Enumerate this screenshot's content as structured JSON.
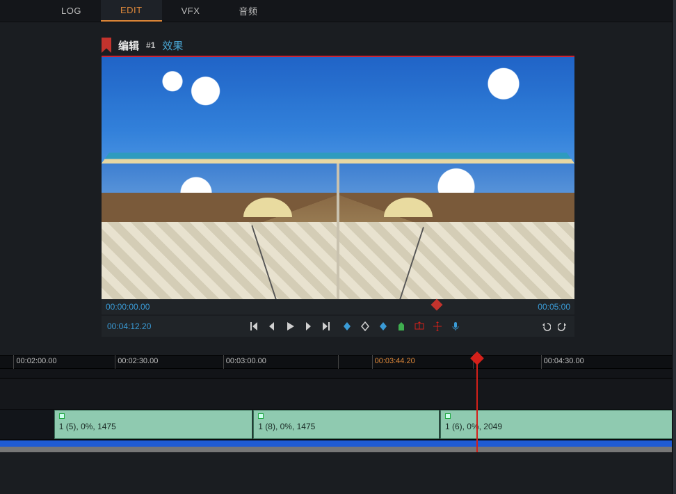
{
  "tabs": {
    "log": "LOG",
    "edit": "EDIT",
    "vfx": "VFX",
    "audio": "音频"
  },
  "viewer": {
    "title_main": "编辑",
    "title_num": "#1",
    "title_fx": "效果",
    "scrub_left": "00:00:00.00",
    "scrub_right": "00:05:00",
    "transport_tc": "00:04:12.20"
  },
  "ruler": {
    "ticks": [
      "00:02:00.00",
      "00:02:30.00",
      "00:03:00.00",
      "",
      "00:03:44.20",
      "",
      "00:04:30.00"
    ],
    "active_index": 4,
    "positions_pct": [
      2,
      17,
      33,
      50,
      55,
      70,
      80
    ]
  },
  "clips": [
    {
      "label": "1 (5), 0%, 1475",
      "width_pct": 32
    },
    {
      "label": "1 (8), 0%, 1475",
      "width_pct": 30
    },
    {
      "label": "1 (6), 0%, 2049",
      "width_pct": 38
    }
  ],
  "playhead_pct": 70.5
}
